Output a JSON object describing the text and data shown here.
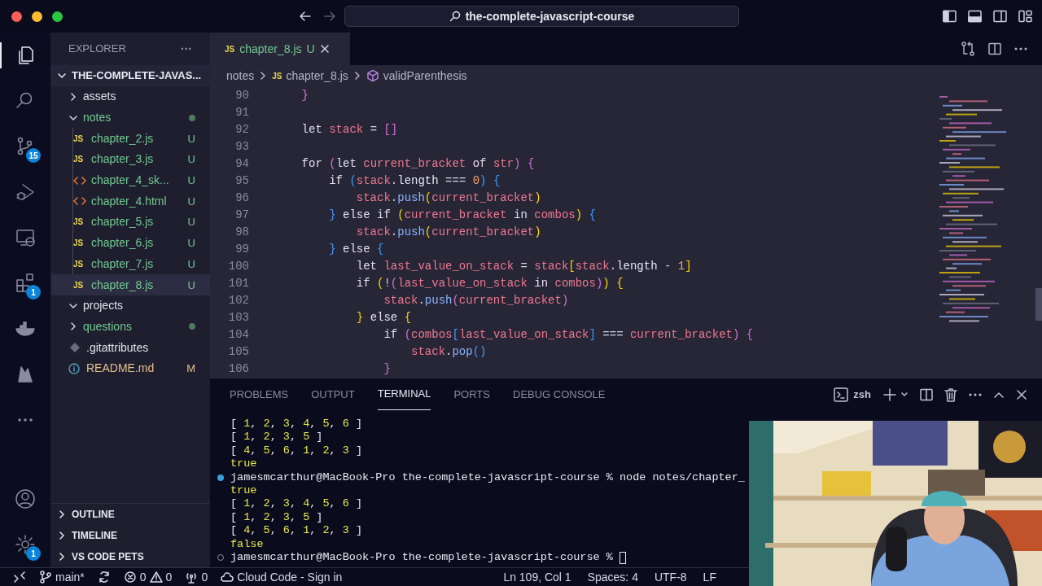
{
  "window": {
    "search": "the-complete-javascript-course"
  },
  "activity_bar": [
    {
      "kind": "files",
      "selected": true
    },
    {
      "kind": "search",
      "selected": false
    },
    {
      "kind": "branch",
      "selected": false,
      "badge": "15"
    },
    {
      "kind": "debug",
      "selected": false
    },
    {
      "kind": "remote",
      "selected": false
    },
    {
      "kind": "extensions",
      "selected": false,
      "badge": "1"
    },
    {
      "kind": "whale",
      "selected": false
    },
    {
      "kind": "flame",
      "selected": false
    },
    {
      "kind": "more",
      "selected": false
    }
  ],
  "activity_bar_bottom": [
    {
      "kind": "account",
      "selected": false
    },
    {
      "kind": "gear",
      "selected": false,
      "badge": "1"
    }
  ],
  "sidebar": {
    "title": "EXPLORER",
    "more": "···",
    "root": {
      "label": "THE-COMPLETE-JAVAS...",
      "expanded": true
    },
    "items": [
      {
        "kind": "folder",
        "label": "assets",
        "expanded": false,
        "color": "#e0e0ea",
        "dot": false,
        "selected": false
      },
      {
        "kind": "folder",
        "label": "notes",
        "expanded": true,
        "color": "#73c991",
        "dot": true,
        "selected": false,
        "children": [
          {
            "kind": "js",
            "icon": "JS",
            "label": "chapter_2.js",
            "color": "#73c991",
            "badge": "U",
            "selected": false
          },
          {
            "kind": "js",
            "icon": "JS",
            "label": "chapter_3.js",
            "color": "#73c991",
            "badge": "U",
            "selected": false
          },
          {
            "kind": "html",
            "label": "chapter_4_sk...",
            "color": "#73c991",
            "badge": "U",
            "selected": false
          },
          {
            "kind": "html",
            "label": "chapter_4.html",
            "color": "#73c991",
            "badge": "U",
            "selected": false
          },
          {
            "kind": "js",
            "icon": "JS",
            "label": "chapter_5.js",
            "color": "#73c991",
            "badge": "U",
            "selected": false
          },
          {
            "kind": "js",
            "icon": "JS",
            "label": "chapter_6.js",
            "color": "#73c991",
            "badge": "U",
            "selected": false
          },
          {
            "kind": "js",
            "icon": "JS",
            "label": "chapter_7.js",
            "color": "#73c991",
            "badge": "U",
            "selected": false
          },
          {
            "kind": "js",
            "icon": "JS",
            "label": "chapter_8.js",
            "color": "#73c991",
            "badge": "U",
            "selected": true
          }
        ]
      },
      {
        "kind": "folder",
        "label": "projects",
        "expanded": true,
        "color": "#e0e0ea",
        "dot": false,
        "selected": false
      },
      {
        "kind": "folder",
        "label": "questions",
        "expanded": false,
        "color": "#73c991",
        "dot": true,
        "selected": false
      },
      {
        "kind": "git",
        "label": ".gitattributes",
        "color": "#e0e0ea",
        "selected": false
      },
      {
        "kind": "info",
        "label": "README.md",
        "color": "#e2c08d",
        "badge": "M",
        "selected": false
      }
    ],
    "sections": [
      {
        "label": "OUTLINE",
        "expanded": false
      },
      {
        "label": "TIMELINE",
        "expanded": false
      },
      {
        "label": "VS CODE PETS",
        "expanded": false
      }
    ]
  },
  "tab": {
    "icon": "JS",
    "label": "chapter_8.js",
    "badge": "U"
  },
  "breadcrumbs": [
    {
      "kind": "folder",
      "label": "notes"
    },
    {
      "kind": "js",
      "label": "chapter_8.js",
      "icon": "JS"
    },
    {
      "kind": "symbol",
      "label": "validParenthesis"
    }
  ],
  "code": [
    {
      "number": "90",
      "tokens": [
        {
          "kind": "bracket1",
          "text": "    }"
        }
      ]
    },
    {
      "number": "91"
    },
    {
      "number": "92",
      "tokens": [
        {
          "kind": "keyword",
          "text": "    let "
        },
        {
          "kind": "variable",
          "text": "stack"
        },
        {
          "kind": "operator",
          "text": " = "
        },
        {
          "kind": "bracket1",
          "text": "[]"
        }
      ]
    },
    {
      "number": "93"
    },
    {
      "number": "94",
      "tokens": [
        {
          "kind": "keyword",
          "text": "    for "
        },
        {
          "kind": "bracket1",
          "text": "("
        },
        {
          "kind": "keyword",
          "text": "let "
        },
        {
          "kind": "variable",
          "text": "current_bracket"
        },
        {
          "kind": "keyword",
          "text": " of "
        },
        {
          "kind": "variable",
          "text": "str"
        },
        {
          "kind": "bracket1",
          "text": ") {"
        }
      ]
    },
    {
      "number": "95",
      "tokens": [
        {
          "kind": "keyword",
          "text": "        if "
        },
        {
          "kind": "bracket2",
          "text": "("
        },
        {
          "kind": "variable",
          "text": "stack"
        },
        {
          "kind": "operator",
          "text": "."
        },
        {
          "kind": "property",
          "text": "length"
        },
        {
          "kind": "operator",
          "text": " === "
        },
        {
          "kind": "number",
          "text": "0"
        },
        {
          "kind": "bracket2",
          "text": ") {"
        }
      ]
    },
    {
      "number": "96",
      "tokens": [
        {
          "kind": "variable",
          "text": "            stack"
        },
        {
          "kind": "operator",
          "text": "."
        },
        {
          "kind": "function",
          "text": "push"
        },
        {
          "kind": "bracket3",
          "text": "("
        },
        {
          "kind": "variable",
          "text": "current_bracket"
        },
        {
          "kind": "bracket3",
          "text": ")"
        }
      ]
    },
    {
      "number": "97",
      "tokens": [
        {
          "kind": "bracket2",
          "text": "        } "
        },
        {
          "kind": "keyword",
          "text": "else if "
        },
        {
          "kind": "bracket3",
          "text": "("
        },
        {
          "kind": "variable",
          "text": "current_bracket"
        },
        {
          "kind": "keyword",
          "text": " in "
        },
        {
          "kind": "variable",
          "text": "combos"
        },
        {
          "kind": "bracket3",
          "text": ")"
        },
        {
          "kind": "bracket2",
          "text": " {"
        }
      ]
    },
    {
      "number": "98",
      "tokens": [
        {
          "kind": "variable",
          "text": "            stack"
        },
        {
          "kind": "operator",
          "text": "."
        },
        {
          "kind": "function",
          "text": "push"
        },
        {
          "kind": "bracket3",
          "text": "("
        },
        {
          "kind": "variable",
          "text": "current_bracket"
        },
        {
          "kind": "bracket3",
          "text": ")"
        }
      ]
    },
    {
      "number": "99",
      "tokens": [
        {
          "kind": "bracket2",
          "text": "        } "
        },
        {
          "kind": "keyword",
          "text": "else "
        },
        {
          "kind": "bracket2",
          "text": "{"
        }
      ]
    },
    {
      "number": "100",
      "tokens": [
        {
          "kind": "keyword",
          "text": "            let "
        },
        {
          "kind": "variable",
          "text": "last_value_on_stack"
        },
        {
          "kind": "operator",
          "text": " = "
        },
        {
          "kind": "variable",
          "text": "stack"
        },
        {
          "kind": "bracket3",
          "text": "["
        },
        {
          "kind": "variable",
          "text": "stack"
        },
        {
          "kind": "operator",
          "text": "."
        },
        {
          "kind": "property",
          "text": "length"
        },
        {
          "kind": "operator",
          "text": " - "
        },
        {
          "kind": "number",
          "text": "1"
        },
        {
          "kind": "bracket3",
          "text": "]"
        }
      ]
    },
    {
      "number": "101",
      "tokens": [
        {
          "kind": "keyword",
          "text": "            if "
        },
        {
          "kind": "bracket3",
          "text": "("
        },
        {
          "kind": "operator",
          "text": "!"
        },
        {
          "kind": "bracket1",
          "text": "("
        },
        {
          "kind": "variable",
          "text": "last_value_on_stack"
        },
        {
          "kind": "keyword",
          "text": " in "
        },
        {
          "kind": "variable",
          "text": "combos"
        },
        {
          "kind": "bracket1",
          "text": ")"
        },
        {
          "kind": "bracket3",
          "text": ") {"
        }
      ]
    },
    {
      "number": "102",
      "tokens": [
        {
          "kind": "variable",
          "text": "                stack"
        },
        {
          "kind": "operator",
          "text": "."
        },
        {
          "kind": "function",
          "text": "push"
        },
        {
          "kind": "bracket1",
          "text": "("
        },
        {
          "kind": "variable",
          "text": "current_bracket"
        },
        {
          "kind": "bracket1",
          "text": ")"
        }
      ]
    },
    {
      "number": "103",
      "tokens": [
        {
          "kind": "bracket3",
          "text": "            } "
        },
        {
          "kind": "keyword",
          "text": "else "
        },
        {
          "kind": "bracket3",
          "text": "{"
        }
      ]
    },
    {
      "number": "104",
      "tokens": [
        {
          "kind": "keyword",
          "text": "                if "
        },
        {
          "kind": "bracket1",
          "text": "("
        },
        {
          "kind": "variable",
          "text": "combos"
        },
        {
          "kind": "bracket2",
          "text": "["
        },
        {
          "kind": "variable",
          "text": "last_value_on_stack"
        },
        {
          "kind": "bracket2",
          "text": "]"
        },
        {
          "kind": "operator",
          "text": " === "
        },
        {
          "kind": "variable",
          "text": "current_bracket"
        },
        {
          "kind": "bracket1",
          "text": ") {"
        }
      ]
    },
    {
      "number": "105",
      "tokens": [
        {
          "kind": "variable",
          "text": "                    stack"
        },
        {
          "kind": "operator",
          "text": "."
        },
        {
          "kind": "function",
          "text": "pop"
        },
        {
          "kind": "bracket2",
          "text": "()"
        }
      ]
    },
    {
      "number": "106",
      "tokens": [
        {
          "kind": "bracket1",
          "text": "                }"
        }
      ]
    }
  ],
  "panel": {
    "tabs": [
      {
        "label": "PROBLEMS",
        "selected": false
      },
      {
        "label": "OUTPUT",
        "selected": false
      },
      {
        "label": "TERMINAL",
        "selected": true
      },
      {
        "label": "PORTS",
        "selected": false
      },
      {
        "label": "DEBUG CONSOLE",
        "selected": false
      }
    ],
    "shell": "zsh"
  },
  "terminal": [
    {
      "prompt": false,
      "tokens": [
        {
          "kind": "plain",
          "text": "[ "
        },
        {
          "kind": "value",
          "text": "1"
        },
        {
          "kind": "plain",
          "text": ", "
        },
        {
          "kind": "value",
          "text": "2"
        },
        {
          "kind": "plain",
          "text": ", "
        },
        {
          "kind": "value",
          "text": "3"
        },
        {
          "kind": "plain",
          "text": ", "
        },
        {
          "kind": "value",
          "text": "4"
        },
        {
          "kind": "plain",
          "text": ", "
        },
        {
          "kind": "value",
          "text": "5"
        },
        {
          "kind": "plain",
          "text": ", "
        },
        {
          "kind": "value",
          "text": "6"
        },
        {
          "kind": "plain",
          "text": " ]"
        }
      ]
    },
    {
      "prompt": false,
      "tokens": [
        {
          "kind": "plain",
          "text": "[ "
        },
        {
          "kind": "value",
          "text": "1"
        },
        {
          "kind": "plain",
          "text": ", "
        },
        {
          "kind": "value",
          "text": "2"
        },
        {
          "kind": "plain",
          "text": ", "
        },
        {
          "kind": "value",
          "text": "3"
        },
        {
          "kind": "plain",
          "text": ", "
        },
        {
          "kind": "value",
          "text": "5"
        },
        {
          "kind": "plain",
          "text": " ]"
        }
      ]
    },
    {
      "prompt": false,
      "tokens": [
        {
          "kind": "plain",
          "text": "[ "
        },
        {
          "kind": "value",
          "text": "4"
        },
        {
          "kind": "plain",
          "text": ", "
        },
        {
          "kind": "value",
          "text": "5"
        },
        {
          "kind": "plain",
          "text": ", "
        },
        {
          "kind": "value",
          "text": "6"
        },
        {
          "kind": "plain",
          "text": ", "
        },
        {
          "kind": "value",
          "text": "1"
        },
        {
          "kind": "plain",
          "text": ", "
        },
        {
          "kind": "value",
          "text": "2"
        },
        {
          "kind": "plain",
          "text": ", "
        },
        {
          "kind": "value",
          "text": "3"
        },
        {
          "kind": "plain",
          "text": " ]"
        }
      ]
    },
    {
      "prompt": false,
      "tokens": [
        {
          "kind": "value",
          "text": "true"
        }
      ]
    },
    {
      "prompt": true,
      "finished": true,
      "tokens": [
        {
          "kind": "plain",
          "text": "jamesmcarthur@MacBook-Pro the-complete-javascript-course % node notes/chapter_"
        }
      ]
    },
    {
      "prompt": false,
      "tokens": [
        {
          "kind": "value",
          "text": "true"
        }
      ]
    },
    {
      "prompt": false,
      "tokens": [
        {
          "kind": "plain",
          "text": "[ "
        },
        {
          "kind": "value",
          "text": "1"
        },
        {
          "kind": "plain",
          "text": ", "
        },
        {
          "kind": "value",
          "text": "2"
        },
        {
          "kind": "plain",
          "text": ", "
        },
        {
          "kind": "value",
          "text": "3"
        },
        {
          "kind": "plain",
          "text": ", "
        },
        {
          "kind": "value",
          "text": "4"
        },
        {
          "kind": "plain",
          "text": ", "
        },
        {
          "kind": "value",
          "text": "5"
        },
        {
          "kind": "plain",
          "text": ", "
        },
        {
          "kind": "value",
          "text": "6"
        },
        {
          "kind": "plain",
          "text": " ]"
        }
      ]
    },
    {
      "prompt": false,
      "tokens": [
        {
          "kind": "plain",
          "text": "[ "
        },
        {
          "kind": "value",
          "text": "1"
        },
        {
          "kind": "plain",
          "text": ", "
        },
        {
          "kind": "value",
          "text": "2"
        },
        {
          "kind": "plain",
          "text": ", "
        },
        {
          "kind": "value",
          "text": "3"
        },
        {
          "kind": "plain",
          "text": ", "
        },
        {
          "kind": "value",
          "text": "5"
        },
        {
          "kind": "plain",
          "text": " ]"
        }
      ]
    },
    {
      "prompt": false,
      "tokens": [
        {
          "kind": "plain",
          "text": "[ "
        },
        {
          "kind": "value",
          "text": "4"
        },
        {
          "kind": "plain",
          "text": ", "
        },
        {
          "kind": "value",
          "text": "5"
        },
        {
          "kind": "plain",
          "text": ", "
        },
        {
          "kind": "value",
          "text": "6"
        },
        {
          "kind": "plain",
          "text": ", "
        },
        {
          "kind": "value",
          "text": "1"
        },
        {
          "kind": "plain",
          "text": ", "
        },
        {
          "kind": "value",
          "text": "2"
        },
        {
          "kind": "plain",
          "text": ", "
        },
        {
          "kind": "value",
          "text": "3"
        },
        {
          "kind": "plain",
          "text": " ]"
        }
      ]
    },
    {
      "prompt": false,
      "tokens": [
        {
          "kind": "value",
          "text": "false"
        }
      ]
    },
    {
      "prompt": true,
      "finished": false,
      "cursor": true,
      "tokens": [
        {
          "kind": "plain",
          "text": "jamesmcarthur@MacBook-Pro the-complete-javascript-course % "
        }
      ]
    }
  ],
  "status_bar": {
    "left": [
      {
        "kind": "remote"
      },
      {
        "kind": "branch",
        "label": "main*"
      },
      {
        "kind": "sync"
      },
      {
        "kind": "errors",
        "label": "0"
      },
      {
        "kind": "warnings",
        "label": "0"
      },
      {
        "kind": "ports",
        "label": "0"
      },
      {
        "kind": "cloud",
        "label": "Cloud Code - Sign in"
      }
    ],
    "right": [
      {
        "label": "Ln 109, Col 1"
      },
      {
        "label": "Spaces: 4"
      },
      {
        "label": "UTF-8"
      },
      {
        "label": "LF"
      }
    ]
  }
}
